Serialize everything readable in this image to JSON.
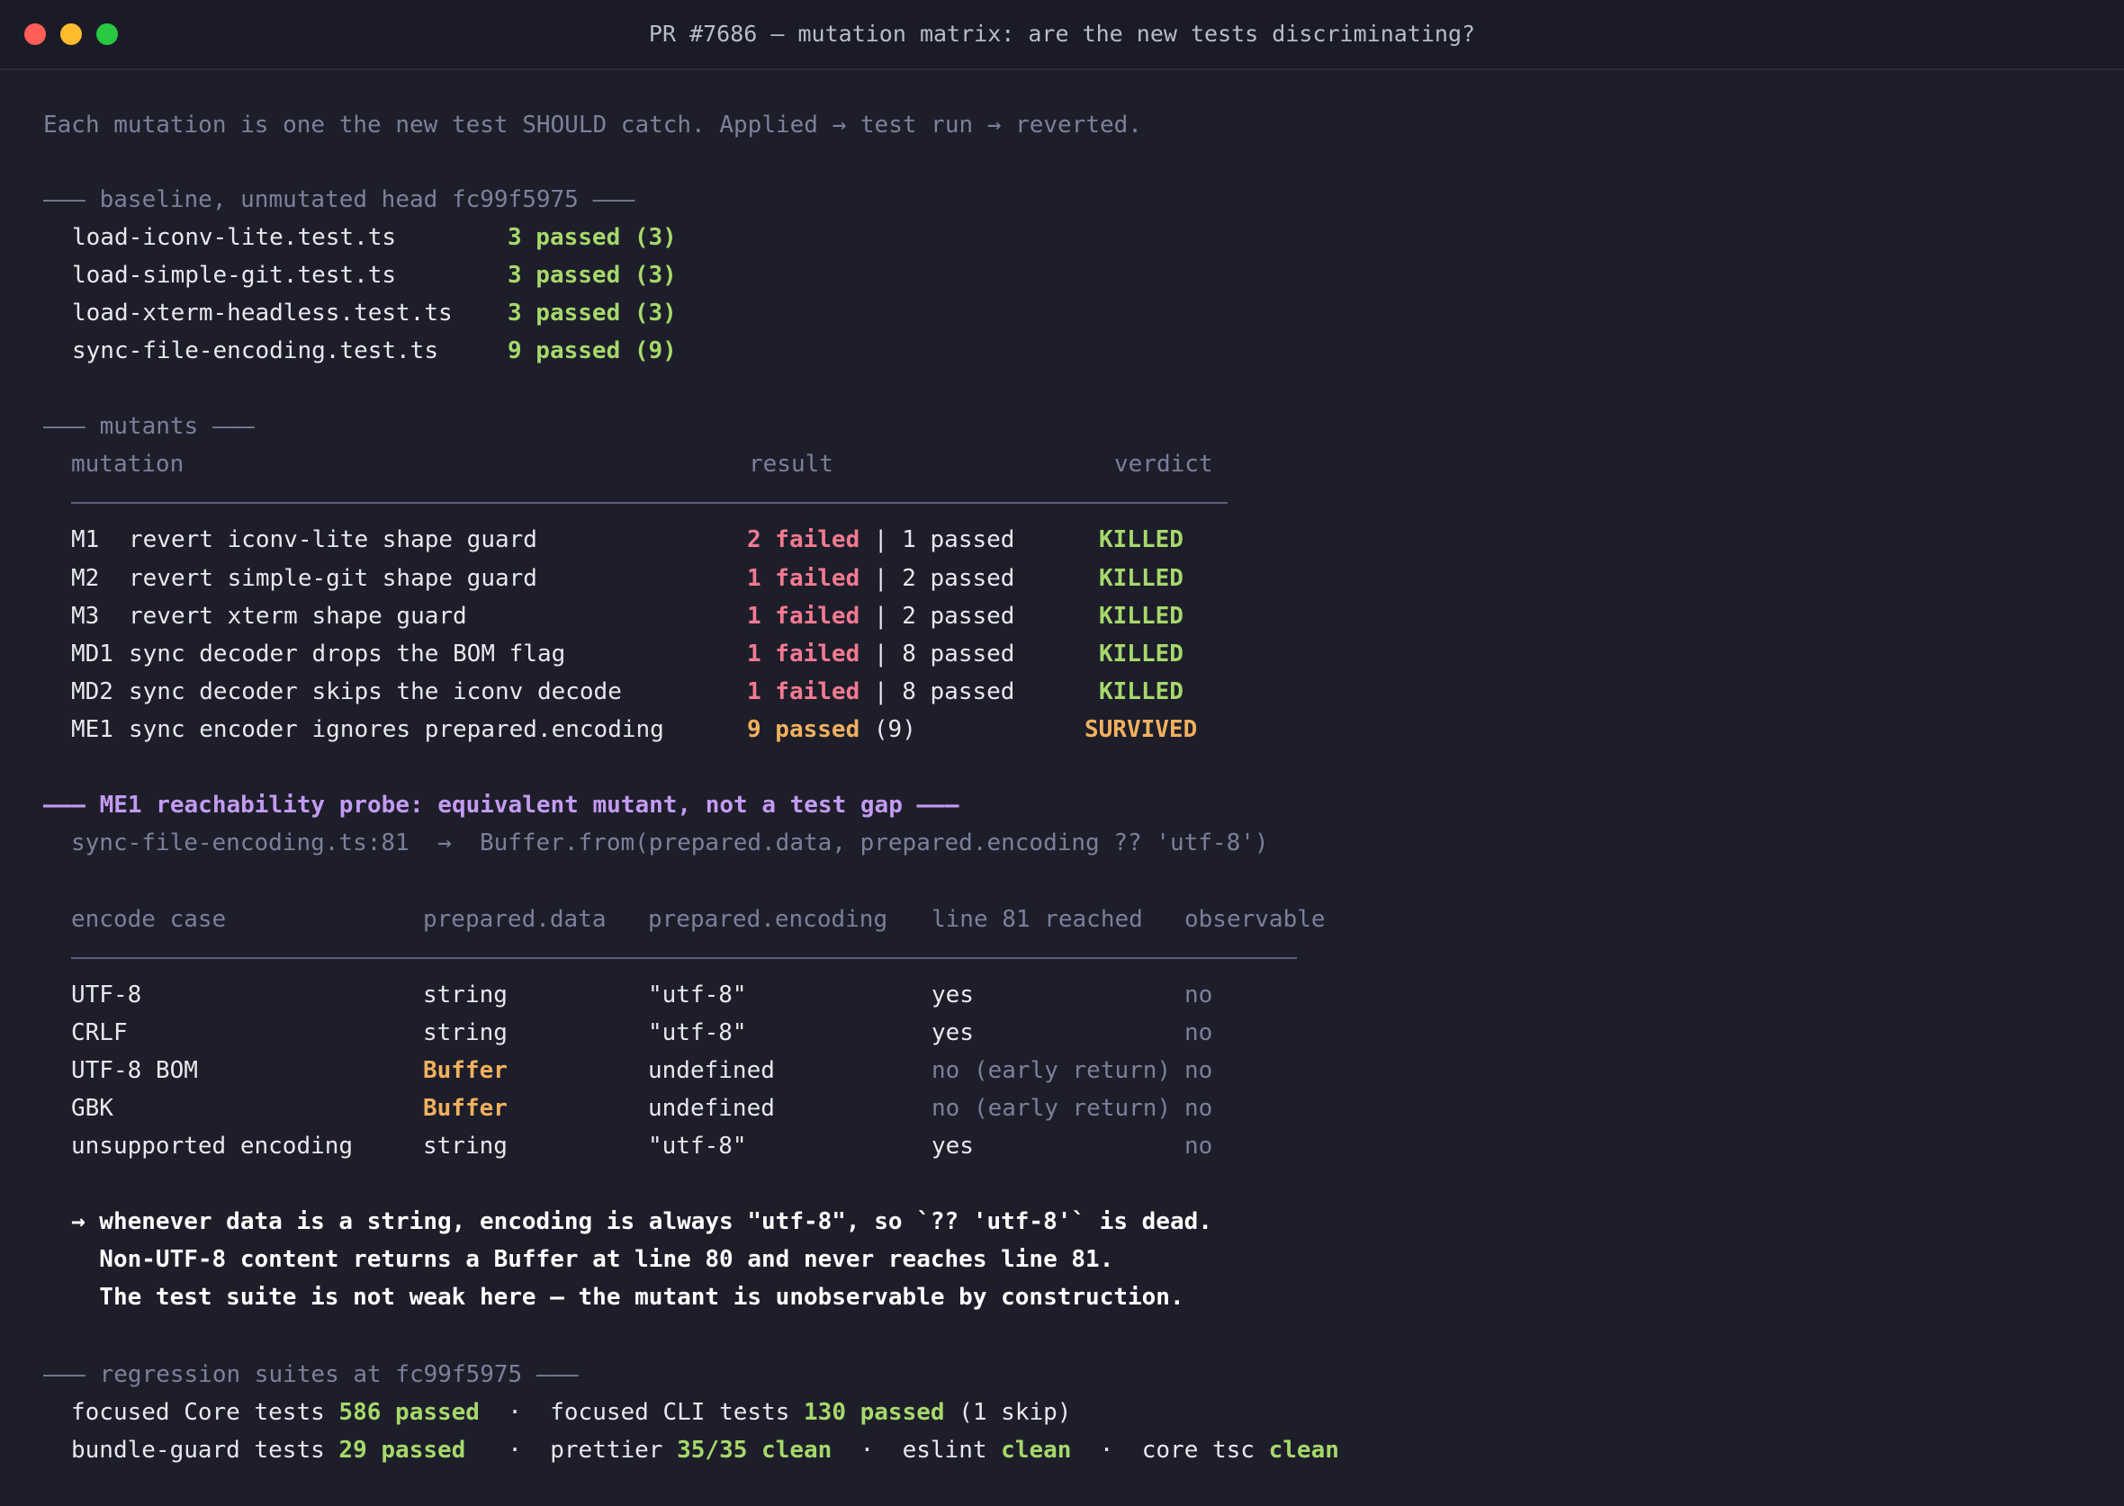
{
  "window": {
    "title": "PR #7686 — mutation matrix: are the new tests discriminating?"
  },
  "intro": "Each mutation is one the new test SHOULD catch. Applied → test run → reverted.",
  "baseline": {
    "header": "——— baseline, unmutated head fc99f5975 ———",
    "rows": [
      {
        "file": "load-iconv-lite.test.ts",
        "result": "3 passed (3)"
      },
      {
        "file": "load-simple-git.test.ts",
        "result": "3 passed (3)"
      },
      {
        "file": "load-xterm-headless.test.ts",
        "result": "3 passed (3)"
      },
      {
        "file": "sync-file-encoding.test.ts",
        "result": "9 passed (9)"
      }
    ]
  },
  "mutants": {
    "header": "——— mutants ———",
    "columns": {
      "mutation": "mutation",
      "result": "result",
      "verdict": "verdict"
    },
    "rows": [
      {
        "id": "M1",
        "desc": "revert iconv-lite shape guard",
        "fail": "2 failed",
        "sep": " | ",
        "pass": "1 passed",
        "verdict": "KILLED"
      },
      {
        "id": "M2",
        "desc": "revert simple-git shape guard",
        "fail": "1 failed",
        "sep": " | ",
        "pass": "2 passed",
        "verdict": "KILLED"
      },
      {
        "id": "M3",
        "desc": "revert xterm shape guard",
        "fail": "1 failed",
        "sep": " | ",
        "pass": "2 passed",
        "verdict": "KILLED"
      },
      {
        "id": "MD1",
        "desc": "sync decoder drops the BOM flag",
        "fail": "1 failed",
        "sep": " | ",
        "pass": "8 passed",
        "verdict": "KILLED"
      },
      {
        "id": "MD2",
        "desc": "sync decoder skips the iconv decode",
        "fail": "1 failed",
        "sep": " | ",
        "pass": "8 passed",
        "verdict": "KILLED"
      }
    ],
    "survivor": {
      "id": "ME1",
      "desc": "sync encoder ignores prepared.encoding",
      "pass": "9 passed",
      "total": " (9)",
      "verdict": "SURVIVED"
    }
  },
  "probe": {
    "header": "——— ME1 reachability probe: equivalent mutant, not a test gap ———",
    "location": "sync-file-encoding.ts:81  →  Buffer.from(prepared.data, prepared.encoding ?? 'utf-8')",
    "columns": {
      "case": "encode case",
      "data": "prepared.data",
      "encoding": "prepared.encoding",
      "reached": "line 81 reached",
      "observable": "observable"
    },
    "rows": [
      {
        "case": "UTF-8",
        "data": "string",
        "encoding": "\"utf-8\"",
        "reached": "yes",
        "observable": "no"
      },
      {
        "case": "CRLF",
        "data": "string",
        "encoding": "\"utf-8\"",
        "reached": "yes",
        "observable": "no"
      },
      {
        "case": "UTF-8 BOM",
        "data": "Buffer",
        "encoding": "undefined",
        "reached": "no (early return)",
        "observable": "no"
      },
      {
        "case": "GBK",
        "data": "Buffer",
        "encoding": "undefined",
        "reached": "no (early return)",
        "observable": "no"
      },
      {
        "case": "unsupported encoding",
        "data": "string",
        "encoding": "\"utf-8\"",
        "reached": "yes",
        "observable": "no"
      }
    ],
    "conclusion": [
      "→ whenever data is a string, encoding is always \"utf-8\", so `?? 'utf-8'` is dead.",
      "  Non-UTF-8 content returns a Buffer at line 80 and never reaches line 81.",
      "  The test suite is not weak here — the mutant is unobservable by construction."
    ]
  },
  "regression": {
    "header": "——— regression suites at fc99f5975 ———",
    "line1": {
      "core_label": "focused Core tests ",
      "core_value": "586 passed",
      "dot": "  ·  ",
      "cli_label": "focused CLI tests ",
      "cli_value": "130 passed",
      "cli_suffix": " (1 skip)"
    },
    "line2": {
      "bundle_label": "bundle-guard tests ",
      "bundle_value": "29 passed",
      "dot": "   ·  ",
      "prettier_label": "prettier ",
      "prettier_value": "35/35 clean",
      "dot2": "  ·  ",
      "eslint_label": "eslint ",
      "eslint_value": "clean",
      "dot3": "  ·  ",
      "tsc_label": "core tsc ",
      "tsc_value": "clean"
    }
  },
  "colors": {
    "background": "#1e1e2b",
    "pass": "#a6d96a",
    "fail": "#f47a90",
    "survived": "#f2b15d",
    "probe": "#c39bf2"
  }
}
